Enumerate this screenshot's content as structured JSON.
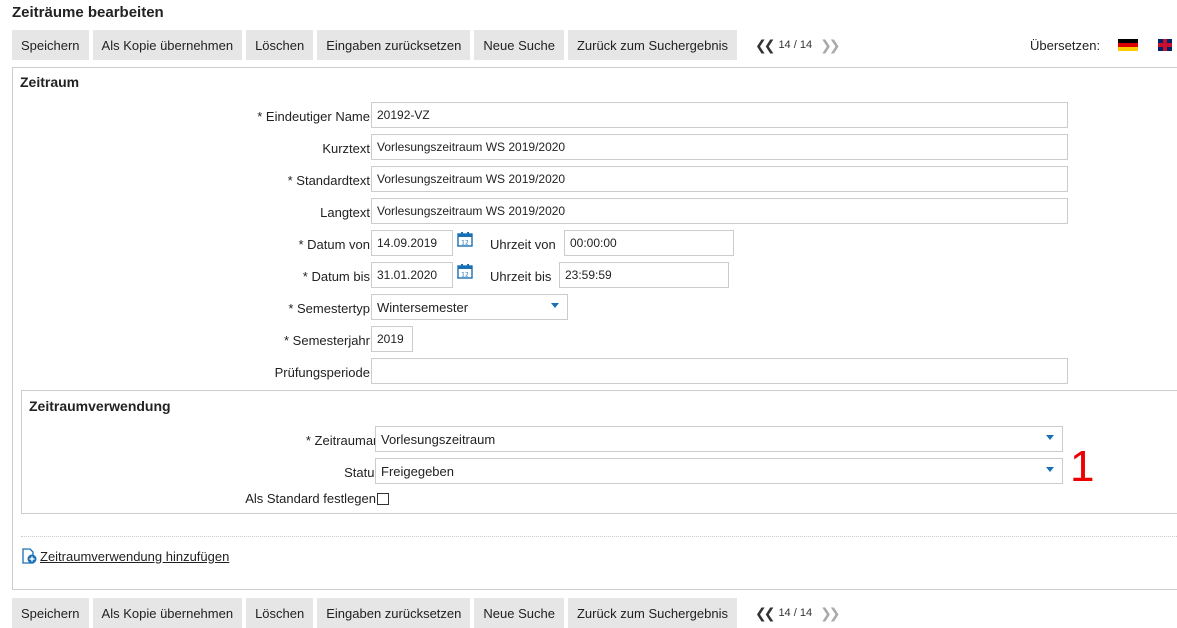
{
  "page": {
    "title": "Zeiträume bearbeiten"
  },
  "toolbar": {
    "save": "Speichern",
    "copy": "Als Kopie übernehmen",
    "delete": "Löschen",
    "reset": "Eingaben zurücksetzen",
    "new_search": "Neue Suche",
    "back_to_results": "Zurück zum Suchergebnis",
    "pager": "14 / 14",
    "translate_label": "Übersetzen:"
  },
  "form": {
    "section_title": "Zeitraum",
    "unique_name": {
      "label": "* Eindeutiger Name",
      "value": "20192-VZ"
    },
    "short_text": {
      "label": "Kurztext",
      "value": "Vorlesungszeitraum WS 2019/2020"
    },
    "standard_text": {
      "label": "* Standardtext",
      "value": "Vorlesungszeitraum WS 2019/2020"
    },
    "long_text": {
      "label": "Langtext",
      "value": "Vorlesungszeitraum WS 2019/2020"
    },
    "date_from": {
      "label": "* Datum von",
      "value": "14.09.2019"
    },
    "time_from": {
      "label": "Uhrzeit von",
      "value": "00:00:00"
    },
    "date_to": {
      "label": "* Datum bis",
      "value": "31.01.2020"
    },
    "time_to": {
      "label": "Uhrzeit bis",
      "value": "23:59:59"
    },
    "semester_type": {
      "label": "* Semestertyp",
      "value": "Wintersemester"
    },
    "semester_year": {
      "label": "* Semesterjahr",
      "value": "2019"
    },
    "exam_period": {
      "label": "Prüfungsperiode",
      "value": ""
    }
  },
  "usage": {
    "section_title": "Zeitraumverwendung",
    "period_type": {
      "label": "* Zeitraumart",
      "value": "Vorlesungszeitraum"
    },
    "status": {
      "label": "Status",
      "value": "Freigegeben"
    },
    "set_default": {
      "label": "Als Standard festlegen",
      "checked": false
    },
    "annotation": "1"
  },
  "add_usage_link": "Zeitraumverwendung hinzufügen",
  "colors": {
    "accent": "#1a6fb5",
    "marker": "#ee0000",
    "button_bg": "#e6e6e6"
  }
}
